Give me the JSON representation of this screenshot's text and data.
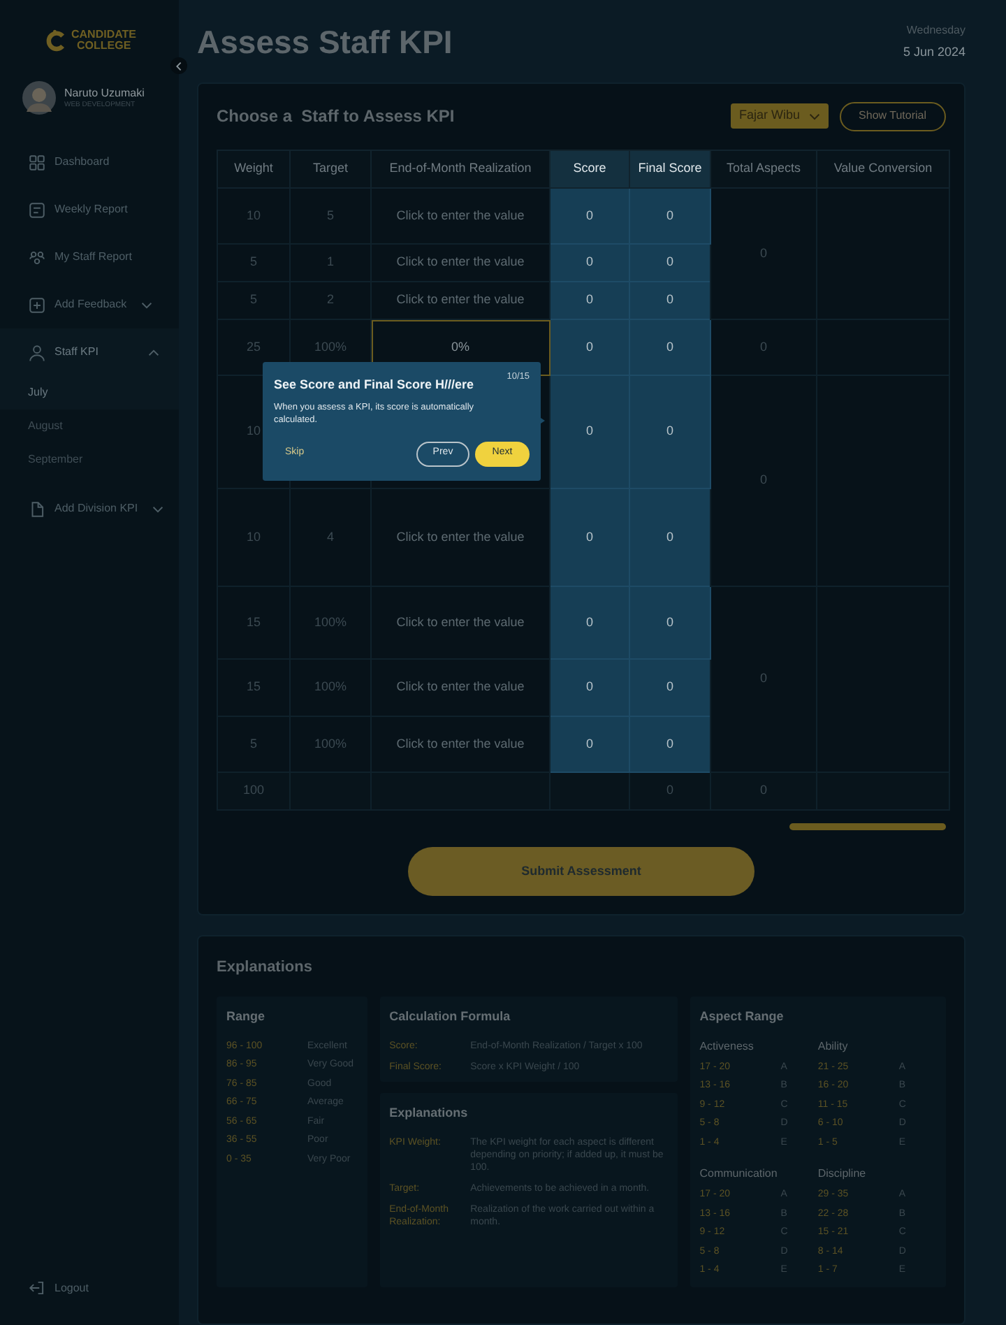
{
  "brand": {
    "line1": "CANDIDATE",
    "line2": "COLLEGE"
  },
  "user": {
    "name": "Naruto Uzumaki",
    "role": "WEB DEVELOPMENT"
  },
  "nav": [
    {
      "label": "Dashboard",
      "selected": false
    },
    {
      "label": "Weekly Report",
      "selected": false
    },
    {
      "label": "My Staff Report",
      "selected": false
    },
    {
      "label": "Add Feedback",
      "selected": false,
      "expanded": false
    },
    {
      "label": "Staff KPI",
      "selected": true,
      "expanded": true,
      "children": [
        {
          "label": "July",
          "selected": true
        },
        {
          "label": "August",
          "selected": false
        },
        {
          "label": "September",
          "selected": false
        }
      ]
    },
    {
      "label": "Add Division KPI",
      "selected": false,
      "expanded": false
    }
  ],
  "logout": "Logout",
  "page_title": "Assess Staff KPI",
  "date": {
    "weekday": "Wednesday",
    "date": "5 Jun 2024"
  },
  "assess": {
    "heading": "Choose a  Staff to Assess KPI",
    "staff_select": "Fajar Wibu",
    "tutorial_button": "Show Tutorial",
    "table": {
      "columns": [
        {
          "label": "Weight",
          "highlighted": false
        },
        {
          "label": "Target",
          "highlighted": false
        },
        {
          "label": "End-of-Month Realization",
          "highlighted": false
        },
        {
          "label": "Score",
          "highlighted": true
        },
        {
          "label": "Final Score",
          "highlighted": true
        },
        {
          "label": "Total Aspects",
          "highlighted": false
        },
        {
          "label": "Value Conversion",
          "highlighted": false
        }
      ],
      "groups": [
        {
          "total_aspects": "0",
          "rows": [
            {
              "weight": "10",
              "target": "5",
              "realization": {
                "placeholder": "Click to enter the value"
              },
              "score": "0",
              "final_score": "0",
              "focused": false
            },
            {
              "weight": "5",
              "target": "1",
              "realization": {
                "placeholder": "Click to enter the value"
              },
              "score": "0",
              "final_score": "0",
              "focused": false
            },
            {
              "weight": "5",
              "target": "2",
              "realization": {
                "placeholder": "Click to enter the value"
              },
              "score": "0",
              "final_score": "0",
              "focused": false
            }
          ]
        },
        {
          "total_aspects": "0",
          "rows": [
            {
              "weight": "25",
              "target": "100%",
              "realization": {
                "value": "0%"
              },
              "score": "0",
              "final_score": "0",
              "focused": true
            }
          ]
        },
        {
          "total_aspects": "0",
          "rows": [
            {
              "weight": "10",
              "score": "0",
              "final_score": "0",
              "focused": false
            },
            {
              "weight": "10",
              "target": "4",
              "realization": {
                "placeholder": "Click to enter the value"
              },
              "score": "0",
              "final_score": "0",
              "focused": false
            }
          ]
        },
        {
          "total_aspects": "0",
          "rows": [
            {
              "weight": "15",
              "target": "100%",
              "realization": {
                "placeholder": "Click to enter the value"
              },
              "score": "0",
              "final_score": "0",
              "focused": false
            },
            {
              "weight": "15",
              "target": "100%",
              "realization": {
                "placeholder": "Click to enter the value"
              },
              "score": "0",
              "final_score": "0",
              "focused": false
            },
            {
              "weight": "5",
              "target": "100%",
              "realization": {
                "placeholder": "Click to enter the value"
              },
              "score": "0",
              "final_score": "0",
              "focused": false
            }
          ]
        }
      ],
      "total": {
        "weight": "100",
        "final_score": "0",
        "total_aspects": "0"
      }
    },
    "submit_button": "Submit Assessment"
  },
  "tour": {
    "title": "See Score and Final Score H///ere",
    "step": "10/15",
    "body": "When you assess a KPI, its score is automatically calculated.",
    "skip": "Skip",
    "prev": "Prev",
    "next": "Next"
  },
  "explanations": {
    "heading": "Explanations",
    "range": {
      "title": "Range",
      "items": [
        {
          "range": "96 - 100",
          "label": "Excellent"
        },
        {
          "range": "86 - 95",
          "label": "Very Good"
        },
        {
          "range": "76 - 85",
          "label": "Good"
        },
        {
          "range": "66 - 75",
          "label": "Average"
        },
        {
          "range": "56 - 65",
          "label": "Fair"
        },
        {
          "range": "36 - 55",
          "label": "Poor"
        },
        {
          "range": "0 - 35",
          "label": "Very Poor"
        }
      ]
    },
    "formula": {
      "title": "Calculation Formula",
      "items": [
        {
          "term": "Score:",
          "text": "End-of-Month Realization / Target x 100"
        },
        {
          "term": "Final Score:",
          "text": "Score x KPI Weight / 100"
        }
      ]
    },
    "terms": {
      "title": "Explanations",
      "items": [
        {
          "term": "KPI Weight:",
          "text": "The KPI weight for each aspect is different depending on priority; if added up, it must be 100."
        },
        {
          "term": "Target:",
          "text": "Achievements to be achieved in a month."
        },
        {
          "term": "End-of-Month Realization:",
          "text": "Realization of the work carried out within a month."
        }
      ]
    },
    "aspect_range": {
      "title": "Aspect Range",
      "groups": [
        {
          "name": "Activeness",
          "items": [
            {
              "range": "17 - 20",
              "grade": "A"
            },
            {
              "range": "13 - 16",
              "grade": "B"
            },
            {
              "range": "9 - 12",
              "grade": "C"
            },
            {
              "range": "5 - 8",
              "grade": "D"
            },
            {
              "range": "1 - 4",
              "grade": "E"
            }
          ]
        },
        {
          "name": "Ability",
          "items": [
            {
              "range": "21 - 25",
              "grade": "A"
            },
            {
              "range": "16 - 20",
              "grade": "B"
            },
            {
              "range": "11 - 15",
              "grade": "C"
            },
            {
              "range": "6 - 10",
              "grade": "D"
            },
            {
              "range": "1 - 5",
              "grade": "E"
            }
          ]
        },
        {
          "name": "Communication",
          "items": [
            {
              "range": "17 - 20",
              "grade": "A"
            },
            {
              "range": "13 - 16",
              "grade": "B"
            },
            {
              "range": "9 - 12",
              "grade": "C"
            },
            {
              "range": "5 - 8",
              "grade": "D"
            },
            {
              "range": "1 - 4",
              "grade": "E"
            }
          ]
        },
        {
          "name": "Discipline",
          "items": [
            {
              "range": "29 - 35",
              "grade": "A"
            },
            {
              "range": "22 - 28",
              "grade": "B"
            },
            {
              "range": "15 - 21",
              "grade": "C"
            },
            {
              "range": "8 - 14",
              "grade": "D"
            },
            {
              "range": "1 - 7",
              "grade": "E"
            }
          ]
        }
      ]
    }
  }
}
